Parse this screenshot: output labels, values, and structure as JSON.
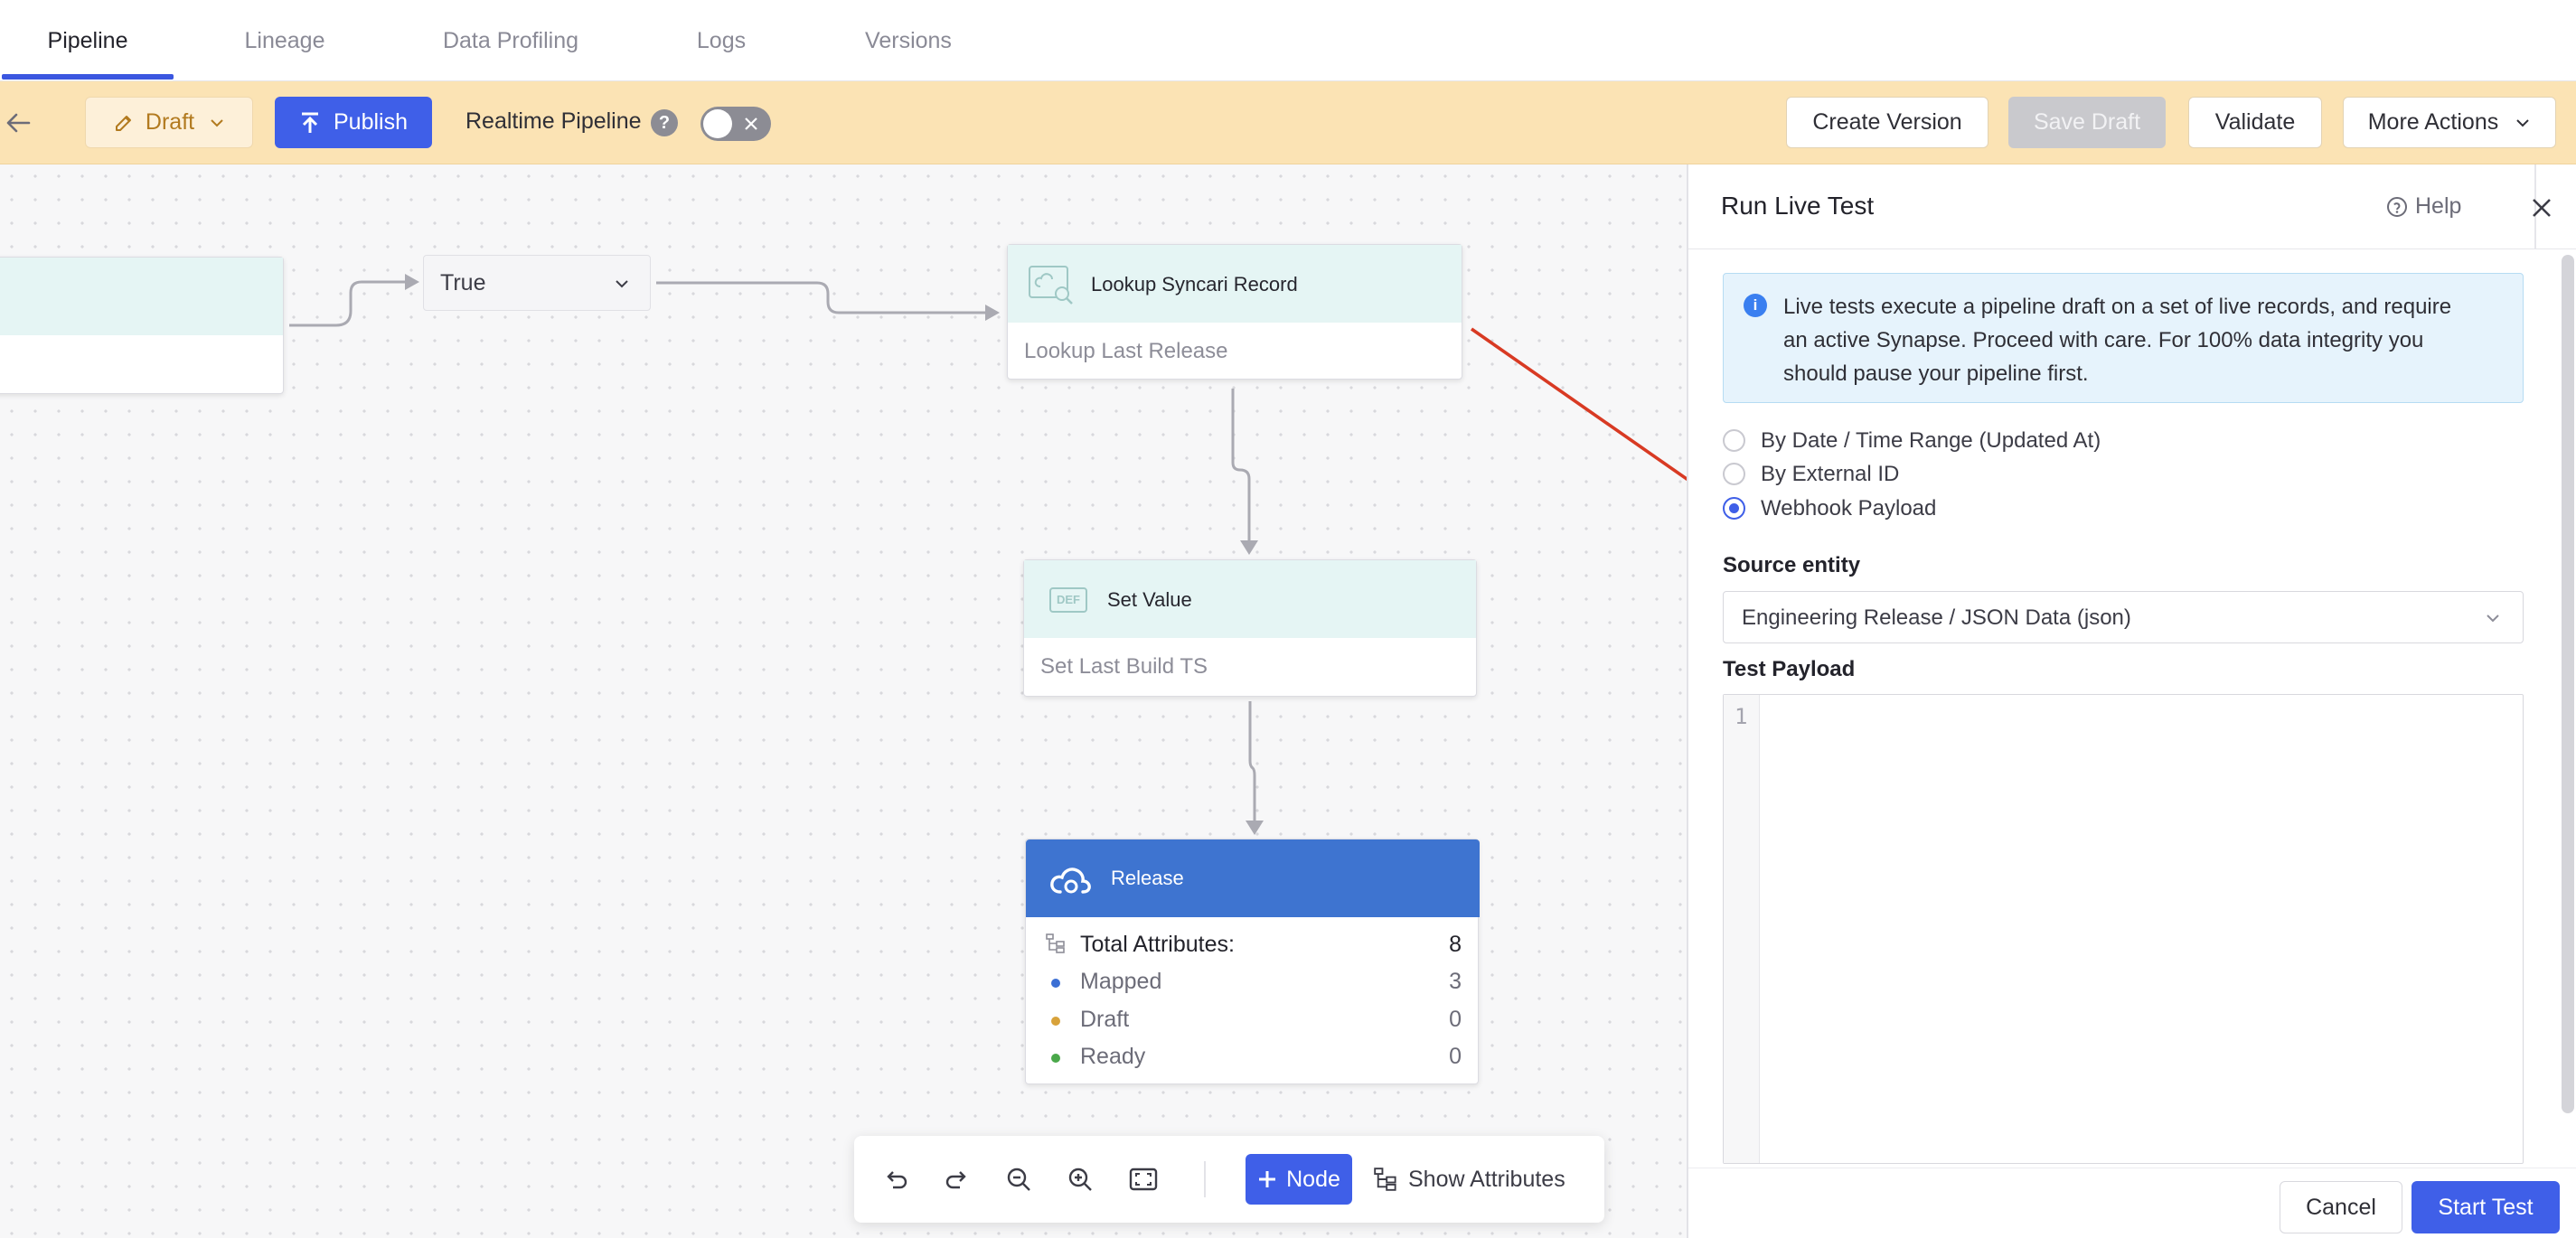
{
  "tabs": [
    {
      "label": "Pipeline",
      "active": true
    },
    {
      "label": "Lineage"
    },
    {
      "label": "Data Profiling"
    },
    {
      "label": "Logs"
    },
    {
      "label": "Versions"
    }
  ],
  "toolbar": {
    "draft_label": "Draft",
    "publish_label": "Publish",
    "realtime_label": "Realtime Pipeline",
    "help_badge": "?",
    "create_version_label": "Create Version",
    "save_draft_label": "Save Draft",
    "validate_label": "Validate",
    "more_actions_label": "More Actions"
  },
  "canvas": {
    "condition_label": "True",
    "lookup_node": {
      "title": "Lookup Syncari Record",
      "subtitle": "Lookup Last Release"
    },
    "set_value_node": {
      "title": "Set Value",
      "subtitle": "Set Last Build TS",
      "icon_text": "DEF"
    },
    "release_node": {
      "title": "Release",
      "total_label": "Total Attributes:",
      "total_value": "8",
      "rows": [
        {
          "label": "Mapped",
          "value": "3",
          "color": "#3b6fd4"
        },
        {
          "label": "Draft",
          "value": "0",
          "color": "#d8a23a"
        },
        {
          "label": "Ready",
          "value": "0",
          "color": "#4aa84a"
        }
      ]
    }
  },
  "bottom_toolbar": {
    "node_label": "Node",
    "show_attributes_label": "Show Attributes"
  },
  "panel": {
    "title": "Run Live Test",
    "help_label": "Help",
    "info_line1": "Live tests execute a pipeline draft on a set of live records, and require",
    "info_line2": "an active Synapse. Proceed with care. For 100% data integrity you",
    "info_line3": "should pause your pipeline first.",
    "options": [
      {
        "label": "By Date / Time Range (Updated At)",
        "selected": false
      },
      {
        "label": "By External ID",
        "selected": false
      },
      {
        "label": "Webhook Payload",
        "selected": true
      }
    ],
    "source_entity_label": "Source entity",
    "source_entity_value": "Engineering Release / JSON Data (json)",
    "test_payload_label": "Test Payload",
    "line_number": "1",
    "cancel_label": "Cancel",
    "start_label": "Start Test"
  },
  "colors": {
    "accent": "#3f5fe8",
    "toolbar_bg": "#fbe3b4",
    "release_header": "#3e74d0",
    "annotation_arrow": "#d83a23"
  }
}
